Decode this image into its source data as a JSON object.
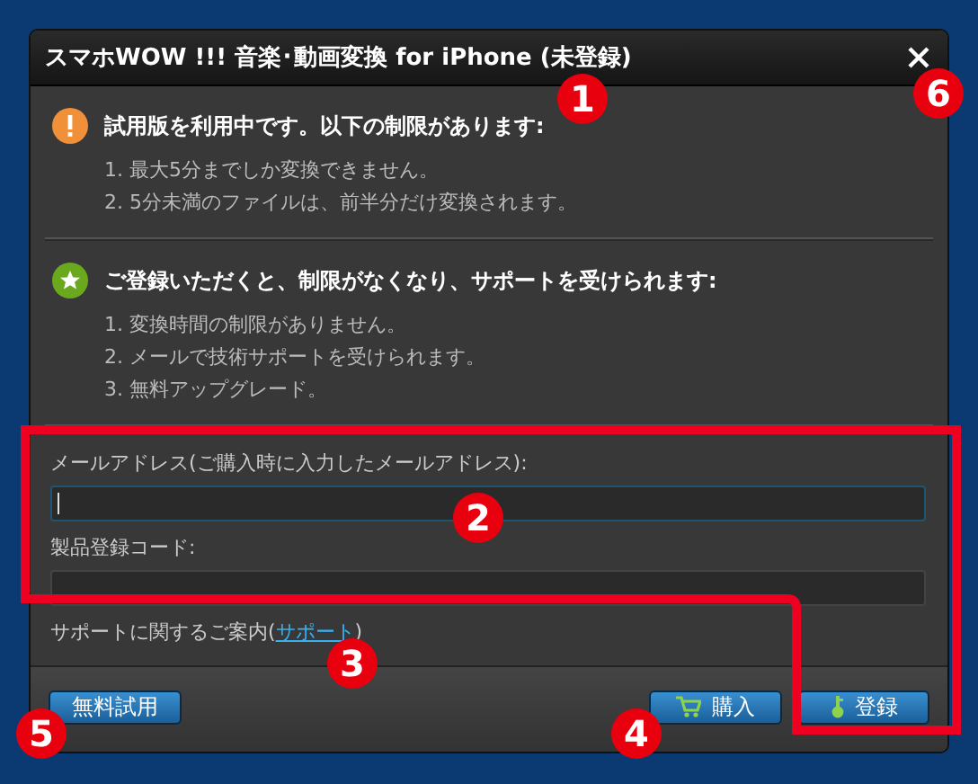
{
  "window": {
    "title": "スマホWOW !!! 音楽･動画変換 for iPhone (未登録)"
  },
  "notices": [
    {
      "kind": "warning",
      "heading": "試用版を利用中です。以下の制限があります:",
      "items": [
        "1. 最大5分までしか変換できません。",
        "2. 5分未満のファイルは、前半分だけ変換されます。"
      ]
    },
    {
      "kind": "benefit",
      "heading": "ご登録いただくと、制限がなくなり、サポートを受けられます:",
      "items": [
        "1. 変換時間の制限がありません。",
        "2. メールで技術サポートを受けられます。",
        "3. 無料アップグレード。"
      ]
    }
  ],
  "form": {
    "fields": [
      {
        "label": "メールアドレス(ご購入時に入力したメールアドレス):",
        "focused": true
      },
      {
        "label": "製品登録コード:",
        "focused": false
      }
    ],
    "support": {
      "text": "サポートに関するご案内(",
      "link": "サポート",
      "suffix": ")"
    }
  },
  "buttons": [
    {
      "label": "無料試用",
      "kind": "trial"
    },
    {
      "label": "購入",
      "kind": "buy"
    },
    {
      "label": "登録",
      "kind": "register"
    }
  ],
  "annotations": [
    {
      "label": "1"
    },
    {
      "label": "2"
    },
    {
      "label": "3"
    },
    {
      "label": "4"
    },
    {
      "label": "5"
    },
    {
      "label": "6"
    }
  ]
}
